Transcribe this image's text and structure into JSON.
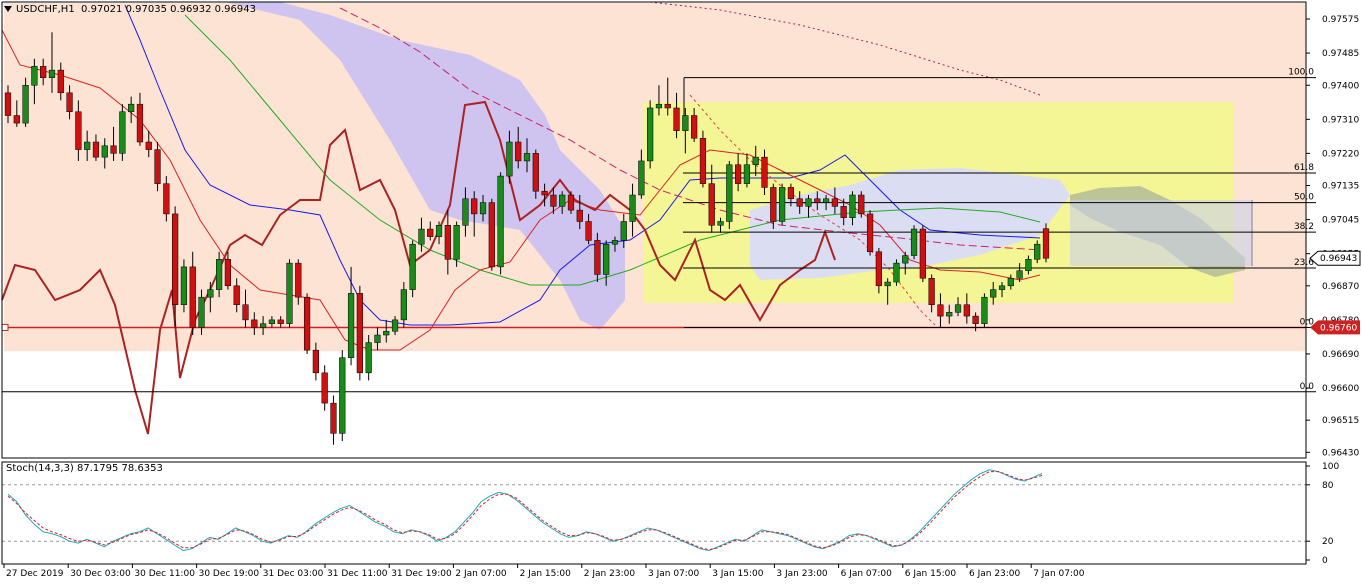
{
  "header": {
    "symbol": "USDCHF,H1",
    "ohlc": "0.97021 0.97035 0.96932 0.96943"
  },
  "stoch_header": "Stoch(14,3,3) 87.1795 78.6353",
  "colors": {
    "bull": "#1a8a1a",
    "bear": "#cc1111",
    "cloud_bear": "#c9c0f2",
    "cloud_bull": "#d9dcf8",
    "peach_zone": "#fde3d4",
    "yellow_box": "#f2f88a",
    "grey_cloud": "#b7bf97",
    "support": "#cc2222",
    "price_tag": "#cc2222",
    "kijun": "#1a1af0",
    "ma_green": "#22aa22",
    "ma_dark": "#aa2222",
    "stoch_main": "#20a8c0",
    "stoch_signal": "#dd2222"
  },
  "chart_data": {
    "type": "candlestick",
    "price_axis": {
      "range": [
        0.96415,
        0.9762
      ],
      "ticks": [
        "0.97575",
        "0.97485",
        "0.97400",
        "0.97310",
        "0.97220",
        "0.97135",
        "0.97045",
        "0.96955",
        "0.96870",
        "0.96780",
        "0.96690",
        "0.96600",
        "0.96515",
        "0.96430"
      ]
    },
    "time_labels": [
      "27 Dec 2019",
      "30 Dec 03:00",
      "30 Dec 11:00",
      "30 Dec 19:00",
      "31 Dec 03:00",
      "31 Dec 11:00",
      "31 Dec 19:00",
      "2 Jan 07:00",
      "2 Jan 15:00",
      "2 Jan 23:00",
      "3 Jan 07:00",
      "3 Jan 15:00",
      "3 Jan 23:00",
      "6 Jan 07:00",
      "6 Jan 15:00",
      "6 Jan 23:00",
      "7 Jan 07:00"
    ],
    "current_price": "0.96943",
    "support_price": "0.96760",
    "fib_upper": [
      {
        "label": "100.0",
        "price": 0.9742
      },
      {
        "label": "61.8",
        "price": 0.97168
      },
      {
        "label": "50.0",
        "price": 0.9709
      },
      {
        "label": "38.2",
        "price": 0.97012
      },
      {
        "label": "23.6",
        "price": 0.96917
      },
      {
        "label": "0.0",
        "price": 0.9676
      }
    ],
    "fib_lower_zero": {
      "label": "0.0",
      "price": 0.9659
    },
    "candles": [
      [
        0.9738,
        0.974,
        0.973,
        0.9732
      ],
      [
        0.9732,
        0.9736,
        0.9729,
        0.973
      ],
      [
        0.973,
        0.9742,
        0.9729,
        0.974
      ],
      [
        0.974,
        0.9747,
        0.9735,
        0.9745
      ],
      [
        0.9745,
        0.9747,
        0.974,
        0.9742
      ],
      [
        0.9742,
        0.9754,
        0.9738,
        0.9744
      ],
      [
        0.9744,
        0.9746,
        0.9736,
        0.9738
      ],
      [
        0.9738,
        0.974,
        0.9731,
        0.9733
      ],
      [
        0.9733,
        0.9736,
        0.972,
        0.9723
      ],
      [
        0.9723,
        0.9728,
        0.972,
        0.9725
      ],
      [
        0.9725,
        0.9727,
        0.972,
        0.9721
      ],
      [
        0.9721,
        0.9726,
        0.9718,
        0.9724
      ],
      [
        0.9724,
        0.9729,
        0.972,
        0.9722
      ],
      [
        0.9722,
        0.9735,
        0.972,
        0.9733
      ],
      [
        0.9733,
        0.9737,
        0.973,
        0.9735
      ],
      [
        0.9735,
        0.9738,
        0.9724,
        0.9725
      ],
      [
        0.9725,
        0.9728,
        0.9721,
        0.9723
      ],
      [
        0.9723,
        0.9725,
        0.9712,
        0.9714
      ],
      [
        0.9714,
        0.9716,
        0.9704,
        0.9706
      ],
      [
        0.9706,
        0.9708,
        0.9676,
        0.9682
      ],
      [
        0.9682,
        0.9694,
        0.968,
        0.9692
      ],
      [
        0.9692,
        0.9696,
        0.9674,
        0.9676
      ],
      [
        0.9676,
        0.9686,
        0.9674,
        0.9684
      ],
      [
        0.9684,
        0.9688,
        0.968,
        0.9686
      ],
      [
        0.9686,
        0.9696,
        0.9684,
        0.9694
      ],
      [
        0.9694,
        0.9696,
        0.9686,
        0.9687
      ],
      [
        0.9687,
        0.9689,
        0.968,
        0.9682
      ],
      [
        0.9682,
        0.9686,
        0.9676,
        0.9678
      ],
      [
        0.9678,
        0.968,
        0.9674,
        0.9676
      ],
      [
        0.9676,
        0.9679,
        0.9674,
        0.9677
      ],
      [
        0.9677,
        0.9679,
        0.9676,
        0.9678
      ],
      [
        0.9678,
        0.9679,
        0.9676,
        0.9677
      ],
      [
        0.9677,
        0.9694,
        0.9676,
        0.9693
      ],
      [
        0.9693,
        0.9694,
        0.9682,
        0.9684
      ],
      [
        0.9684,
        0.9685,
        0.9669,
        0.967
      ],
      [
        0.967,
        0.9672,
        0.9662,
        0.9664
      ],
      [
        0.9664,
        0.9666,
        0.9654,
        0.9656
      ],
      [
        0.9656,
        0.9658,
        0.9645,
        0.9648
      ],
      [
        0.9648,
        0.967,
        0.9646,
        0.9668
      ],
      [
        0.9668,
        0.9692,
        0.9666,
        0.9685
      ],
      [
        0.9685,
        0.9687,
        0.9662,
        0.9664
      ],
      [
        0.9664,
        0.9674,
        0.9662,
        0.9672
      ],
      [
        0.9672,
        0.9676,
        0.967,
        0.9674
      ],
      [
        0.9674,
        0.9678,
        0.9672,
        0.9675
      ],
      [
        0.9675,
        0.9679,
        0.9674,
        0.9678
      ],
      [
        0.9678,
        0.9688,
        0.9676,
        0.9686
      ],
      [
        0.9686,
        0.9699,
        0.9684,
        0.9698
      ],
      [
        0.9698,
        0.9705,
        0.9696,
        0.9702
      ],
      [
        0.9702,
        0.9704,
        0.9699,
        0.97
      ],
      [
        0.97,
        0.9704,
        0.9698,
        0.9703
      ],
      [
        0.9703,
        0.9707,
        0.969,
        0.9694
      ],
      [
        0.9694,
        0.9704,
        0.9692,
        0.9703
      ],
      [
        0.9703,
        0.9713,
        0.97,
        0.971
      ],
      [
        0.971,
        0.9712,
        0.97,
        0.9706
      ],
      [
        0.9706,
        0.9711,
        0.9704,
        0.9709
      ],
      [
        0.9709,
        0.971,
        0.9691,
        0.9692
      ],
      [
        0.9692,
        0.9717,
        0.969,
        0.9716
      ],
      [
        0.9716,
        0.9728,
        0.9714,
        0.9725
      ],
      [
        0.9725,
        0.9729,
        0.9718,
        0.972
      ],
      [
        0.972,
        0.9726,
        0.9717,
        0.9722
      ],
      [
        0.9722,
        0.9723,
        0.971,
        0.9712
      ],
      [
        0.9712,
        0.9714,
        0.9708,
        0.9711
      ],
      [
        0.9711,
        0.9713,
        0.9706,
        0.9708
      ],
      [
        0.9708,
        0.9712,
        0.9706,
        0.9711
      ],
      [
        0.9711,
        0.9712,
        0.9706,
        0.9707
      ],
      [
        0.9707,
        0.9711,
        0.9702,
        0.9704
      ],
      [
        0.9704,
        0.9706,
        0.9698,
        0.9699
      ],
      [
        0.9699,
        0.9701,
        0.9688,
        0.969
      ],
      [
        0.969,
        0.9699,
        0.9687,
        0.9698
      ],
      [
        0.9698,
        0.97,
        0.9696,
        0.9699
      ],
      [
        0.9699,
        0.9706,
        0.9697,
        0.9704
      ],
      [
        0.9704,
        0.9714,
        0.97,
        0.9711
      ],
      [
        0.9711,
        0.9723,
        0.971,
        0.972
      ],
      [
        0.972,
        0.9736,
        0.9718,
        0.9734
      ],
      [
        0.9734,
        0.974,
        0.9732,
        0.9735
      ],
      [
        0.9735,
        0.9742,
        0.9732,
        0.9734
      ],
      [
        0.9734,
        0.9738,
        0.9726,
        0.9728
      ],
      [
        0.9728,
        0.9734,
        0.9722,
        0.9732
      ],
      [
        0.9732,
        0.9734,
        0.9725,
        0.9726
      ],
      [
        0.9726,
        0.9728,
        0.9713,
        0.9714
      ],
      [
        0.9714,
        0.9719,
        0.9701,
        0.9703
      ],
      [
        0.9703,
        0.9705,
        0.9701,
        0.9704
      ],
      [
        0.9704,
        0.972,
        0.9702,
        0.9719
      ],
      [
        0.9719,
        0.9722,
        0.9712,
        0.9714
      ],
      [
        0.9714,
        0.9722,
        0.9713,
        0.9719
      ],
      [
        0.9719,
        0.9724,
        0.9716,
        0.9721
      ],
      [
        0.9721,
        0.9723,
        0.9711,
        0.9713
      ],
      [
        0.9713,
        0.9714,
        0.9702,
        0.9704
      ],
      [
        0.9704,
        0.9714,
        0.9703,
        0.9713
      ],
      [
        0.9713,
        0.9714,
        0.9708,
        0.971
      ],
      [
        0.971,
        0.9712,
        0.9706,
        0.9708
      ],
      [
        0.9708,
        0.9711,
        0.9705,
        0.971
      ],
      [
        0.971,
        0.9712,
        0.9707,
        0.9709
      ],
      [
        0.9709,
        0.9711,
        0.9707,
        0.971
      ],
      [
        0.971,
        0.9713,
        0.9706,
        0.9708
      ],
      [
        0.9708,
        0.971,
        0.9703,
        0.9705
      ],
      [
        0.9705,
        0.9712,
        0.9703,
        0.9711
      ],
      [
        0.9711,
        0.9712,
        0.9705,
        0.9706
      ],
      [
        0.9706,
        0.9707,
        0.9695,
        0.9696
      ],
      [
        0.9696,
        0.9697,
        0.9685,
        0.9687
      ],
      [
        0.9687,
        0.9689,
        0.9682,
        0.9688
      ],
      [
        0.9688,
        0.9694,
        0.9687,
        0.9693
      ],
      [
        0.9693,
        0.9696,
        0.969,
        0.9695
      ],
      [
        0.9695,
        0.9703,
        0.9694,
        0.9702
      ],
      [
        0.9702,
        0.9703,
        0.9688,
        0.9689
      ],
      [
        0.9689,
        0.969,
        0.968,
        0.9682
      ],
      [
        0.9682,
        0.9685,
        0.9676,
        0.9679
      ],
      [
        0.9679,
        0.9682,
        0.9677,
        0.968
      ],
      [
        0.968,
        0.9684,
        0.9679,
        0.9682
      ],
      [
        0.9682,
        0.9685,
        0.9677,
        0.9679
      ],
      [
        0.9679,
        0.968,
        0.9675,
        0.9677
      ],
      [
        0.9677,
        0.9685,
        0.9676,
        0.9684
      ],
      [
        0.9684,
        0.9688,
        0.9682,
        0.9686
      ],
      [
        0.9686,
        0.9688,
        0.9684,
        0.9687
      ],
      [
        0.9687,
        0.969,
        0.9686,
        0.9689
      ],
      [
        0.9689,
        0.9693,
        0.9688,
        0.9691
      ],
      [
        0.9691,
        0.9695,
        0.969,
        0.9694
      ],
      [
        0.9694,
        0.9699,
        0.9693,
        0.9698
      ],
      [
        0.97021,
        0.97035,
        0.96932,
        0.96943
      ]
    ],
    "stoch_axis": {
      "range": [
        0,
        100
      ],
      "ticks": [
        "100",
        "80",
        "20",
        "0"
      ]
    },
    "stoch_main": [
      70,
      62,
      48,
      38,
      30,
      28,
      25,
      20,
      18,
      22,
      18,
      14,
      20,
      24,
      28,
      30,
      34,
      28,
      22,
      16,
      10,
      12,
      18,
      24,
      22,
      28,
      34,
      30,
      26,
      20,
      18,
      22,
      26,
      24,
      30,
      38,
      44,
      50,
      55,
      58,
      52,
      46,
      40,
      36,
      30,
      28,
      32,
      30,
      26,
      20,
      24,
      30,
      40,
      50,
      62,
      68,
      72,
      70,
      64,
      56,
      48,
      40,
      34,
      28,
      24,
      26,
      30,
      28,
      24,
      20,
      22,
      26,
      30,
      34,
      32,
      28,
      24,
      20,
      16,
      12,
      10,
      14,
      18,
      22,
      20,
      26,
      32,
      30,
      28,
      26,
      22,
      18,
      14,
      12,
      16,
      20,
      26,
      28,
      26,
      22,
      18,
      14,
      16,
      22,
      30,
      40,
      50,
      60,
      70,
      78,
      86,
      92,
      96,
      94,
      90,
      86,
      84,
      88,
      92
    ],
    "stoch_signal": [
      68,
      60,
      50,
      42,
      34,
      30,
      27,
      23,
      20,
      21,
      19,
      16,
      19,
      23,
      27,
      29,
      32,
      29,
      24,
      18,
      13,
      13,
      17,
      22,
      23,
      27,
      32,
      31,
      27,
      22,
      19,
      21,
      25,
      25,
      29,
      36,
      42,
      48,
      53,
      56,
      53,
      48,
      42,
      38,
      32,
      29,
      31,
      30,
      27,
      22,
      23,
      28,
      37,
      47,
      58,
      65,
      70,
      70,
      66,
      58,
      50,
      42,
      36,
      30,
      26,
      26,
      29,
      28,
      25,
      21,
      22,
      25,
      29,
      32,
      32,
      29,
      25,
      21,
      17,
      13,
      11,
      13,
      17,
      21,
      21,
      25,
      30,
      30,
      29,
      27,
      23,
      19,
      15,
      13,
      15,
      19,
      24,
      27,
      26,
      23,
      19,
      15,
      16,
      21,
      28,
      37,
      47,
      57,
      67,
      75,
      83,
      89,
      94,
      94,
      91,
      87,
      85,
      87,
      90
    ]
  }
}
